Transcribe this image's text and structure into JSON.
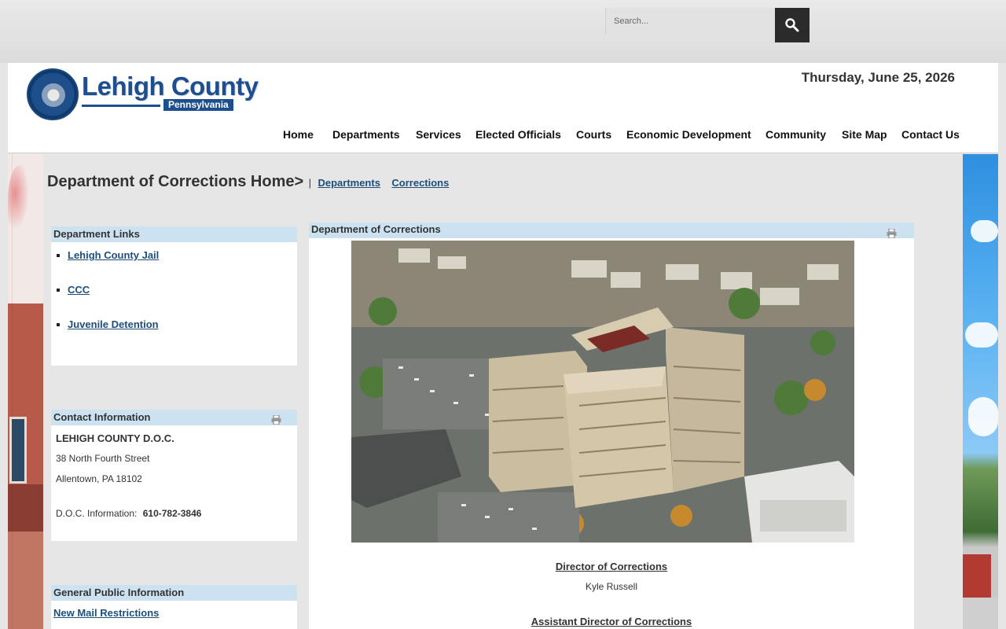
{
  "search": {
    "placeholder": "Search..."
  },
  "header": {
    "logo_title": "Lehigh County",
    "logo_subtitle": "Pennsylvania",
    "date": "Thursday, June 25, 2026"
  },
  "nav": [
    "Home",
    "Departments",
    "Services",
    "Elected Officials",
    "Courts",
    "Economic Development",
    "Community",
    "Site Map",
    "Contact Us"
  ],
  "page": {
    "title": "Department of Corrections Home>",
    "separator": "|",
    "breadcrumbs": [
      "Departments",
      "Corrections"
    ]
  },
  "department_links": {
    "heading": "Department Links",
    "items": [
      "Lehigh County Jail",
      "CCC",
      "Juvenile Detention"
    ]
  },
  "contact": {
    "heading": "Contact Information",
    "name": "LEHIGH COUNTY D.O.C.",
    "street": "38 North Fourth Street",
    "city": "Allentown, PA 18102",
    "info_label": "D.O.C. Information:",
    "phone": "610-782-3846"
  },
  "general": {
    "heading": "General Public Information",
    "link": "New Mail Restrictions"
  },
  "main": {
    "heading": "Department of Corrections",
    "director_title": "Director of Corrections",
    "director_name": "Kyle Russell",
    "assistant_title": "Assistant Director of Corrections"
  },
  "icons": [
    "search-icon",
    "print-icon",
    "county-seal-icon"
  ]
}
